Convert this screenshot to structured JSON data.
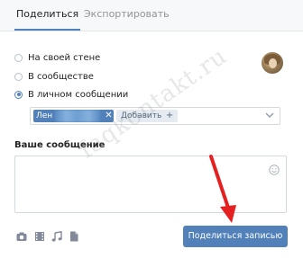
{
  "tabs": [
    {
      "label": "Поделиться",
      "active": true
    },
    {
      "label": "Экспортировать",
      "active": false
    }
  ],
  "share_options": [
    {
      "label": "На своей стене",
      "checked": false
    },
    {
      "label": "В сообществе",
      "checked": false
    },
    {
      "label": "В личном сообщении",
      "checked": true
    }
  ],
  "recipients": {
    "chip_label": "Лен",
    "add_label": "Добавить"
  },
  "message": {
    "label": "Ваше сообщение",
    "value": ""
  },
  "attachments": [
    "camera-icon",
    "video-icon",
    "music-icon",
    "document-icon"
  ],
  "share_button": "Поделиться записью",
  "watermark": "faqkontakt.ru",
  "colors": {
    "accent": "#5181b8",
    "arrow": "#e52020",
    "tab_bar_bg": "#f7f8fa",
    "border": "#d3d9de"
  }
}
